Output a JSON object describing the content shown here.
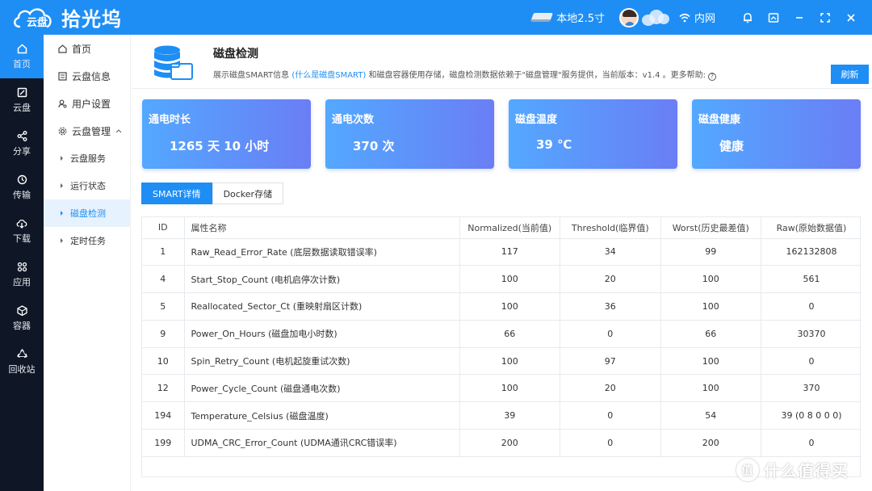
{
  "app": {
    "brand": "拾光坞",
    "logo_text": "云盘"
  },
  "topbar": {
    "disk_label": "本地2.5寸",
    "network_label": "内网"
  },
  "rail": [
    {
      "label": "首页",
      "icon": "home-icon"
    },
    {
      "label": "云盘",
      "icon": "cloud-disk-icon"
    },
    {
      "label": "分享",
      "icon": "share-icon"
    },
    {
      "label": "传输",
      "icon": "transfer-icon"
    },
    {
      "label": "下载",
      "icon": "download-icon"
    },
    {
      "label": "应用",
      "icon": "apps-icon"
    },
    {
      "label": "容器",
      "icon": "container-icon"
    },
    {
      "label": "回收站",
      "icon": "recycle-icon"
    }
  ],
  "subnav": {
    "items": [
      {
        "label": "首页"
      },
      {
        "label": "云盘信息"
      },
      {
        "label": "用户设置"
      },
      {
        "label": "云盘管理"
      }
    ],
    "children": [
      {
        "label": "云盘服务"
      },
      {
        "label": "运行状态"
      },
      {
        "label": "磁盘检测"
      },
      {
        "label": "定时任务"
      }
    ]
  },
  "header": {
    "title": "磁盘检测",
    "desc_prefix": "展示磁盘SMART信息 ",
    "desc_link": "(什么是磁盘SMART)",
    "desc_suffix": " 和磁盘容器使用存储，磁盘检测数据依赖于\"磁盘管理\"服务提供，当前版本：v1.4 。更多帮助:",
    "refresh_label": "刷新"
  },
  "cards": [
    {
      "label": "通电时长",
      "value": "1265 天 10 小时"
    },
    {
      "label": "通电次数",
      "value": "370 次"
    },
    {
      "label": "磁盘温度",
      "value": "39 ℃"
    },
    {
      "label": "磁盘健康",
      "value": "健康"
    }
  ],
  "tabs": [
    "SMART详情",
    "Docker存储"
  ],
  "table": {
    "headers": [
      "ID",
      "属性名称",
      "Normalized(当前值)",
      "Threshold(临界值)",
      "Worst(历史最差值)",
      "Raw(原始数据值)"
    ],
    "rows": [
      [
        "1",
        "Raw_Read_Error_Rate (底层数据读取错误率)",
        "117",
        "34",
        "99",
        "162132808"
      ],
      [
        "4",
        "Start_Stop_Count (电机启停次计数)",
        "100",
        "20",
        "100",
        "561"
      ],
      [
        "5",
        "Reallocated_Sector_Ct (重映射扇区计数)",
        "100",
        "36",
        "100",
        "0"
      ],
      [
        "9",
        "Power_On_Hours (磁盘加电小时数)",
        "66",
        "0",
        "66",
        "30370"
      ],
      [
        "10",
        "Spin_Retry_Count (电机起旋重试次数)",
        "100",
        "97",
        "100",
        "0"
      ],
      [
        "12",
        "Power_Cycle_Count (磁盘通电次数)",
        "100",
        "20",
        "100",
        "370"
      ],
      [
        "194",
        "Temperature_Celsius (磁盘温度)",
        "39",
        "0",
        "54",
        "39 (0 8 0 0 0)"
      ],
      [
        "199",
        "UDMA_CRC_Error_Count (UDMA通讯CRC错误率)",
        "200",
        "0",
        "200",
        "0"
      ]
    ]
  },
  "watermark": {
    "text": "什么值得买",
    "glyph": "值"
  },
  "colors": {
    "primary": "#1e8ef5",
    "rail_bg": "#0f1726",
    "card_from": "#53a8ff",
    "card_to": "#6a7ef5"
  }
}
